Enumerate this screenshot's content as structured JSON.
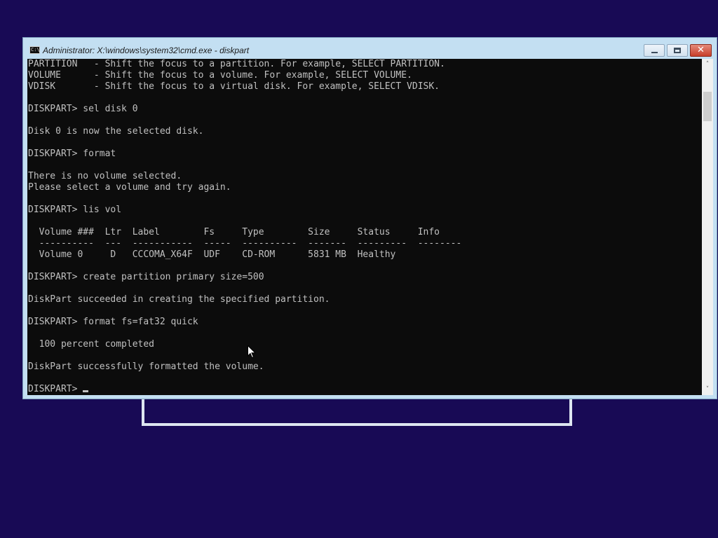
{
  "window": {
    "title": "Administrator: X:\\windows\\system32\\cmd.exe - diskpart",
    "icon_text": "C:\\",
    "buttons": {
      "minimize_icon": "minimize-icon",
      "maximize_icon": "restore-icon",
      "close_icon": "close-icon",
      "close_glyph": "✕"
    }
  },
  "console": {
    "lines": [
      "PARTITION   - Shift the focus to a partition. For example, SELECT PARTITION.",
      "VOLUME      - Shift the focus to a volume. For example, SELECT VOLUME.",
      "VDISK       - Shift the focus to a virtual disk. For example, SELECT VDISK.",
      "",
      "DISKPART> sel disk 0",
      "",
      "Disk 0 is now the selected disk.",
      "",
      "DISKPART> format",
      "",
      "There is no volume selected.",
      "Please select a volume and try again.",
      "",
      "DISKPART> lis vol",
      "",
      "  Volume ###  Ltr  Label        Fs     Type        Size     Status     Info",
      "  ----------  ---  -----------  -----  ----------  -------  ---------  --------",
      "  Volume 0     D   CCCOMA_X64F  UDF    CD-ROM      5831 MB  Healthy",
      "",
      "DISKPART> create partition primary size=500",
      "",
      "DiskPart succeeded in creating the specified partition.",
      "",
      "DISKPART> format fs=fat32 quick",
      "",
      "  100 percent completed",
      "",
      "DiskPart successfully formatted the volume.",
      ""
    ],
    "prompt": "DISKPART> "
  },
  "scrollbar": {
    "up_arrow": "˄",
    "down_arrow": "˅"
  },
  "colors": {
    "desktop": "#180a55",
    "console_bg": "#0c0c0c",
    "console_fg": "#c0c0c0",
    "window_frame": "#c3dff2"
  }
}
